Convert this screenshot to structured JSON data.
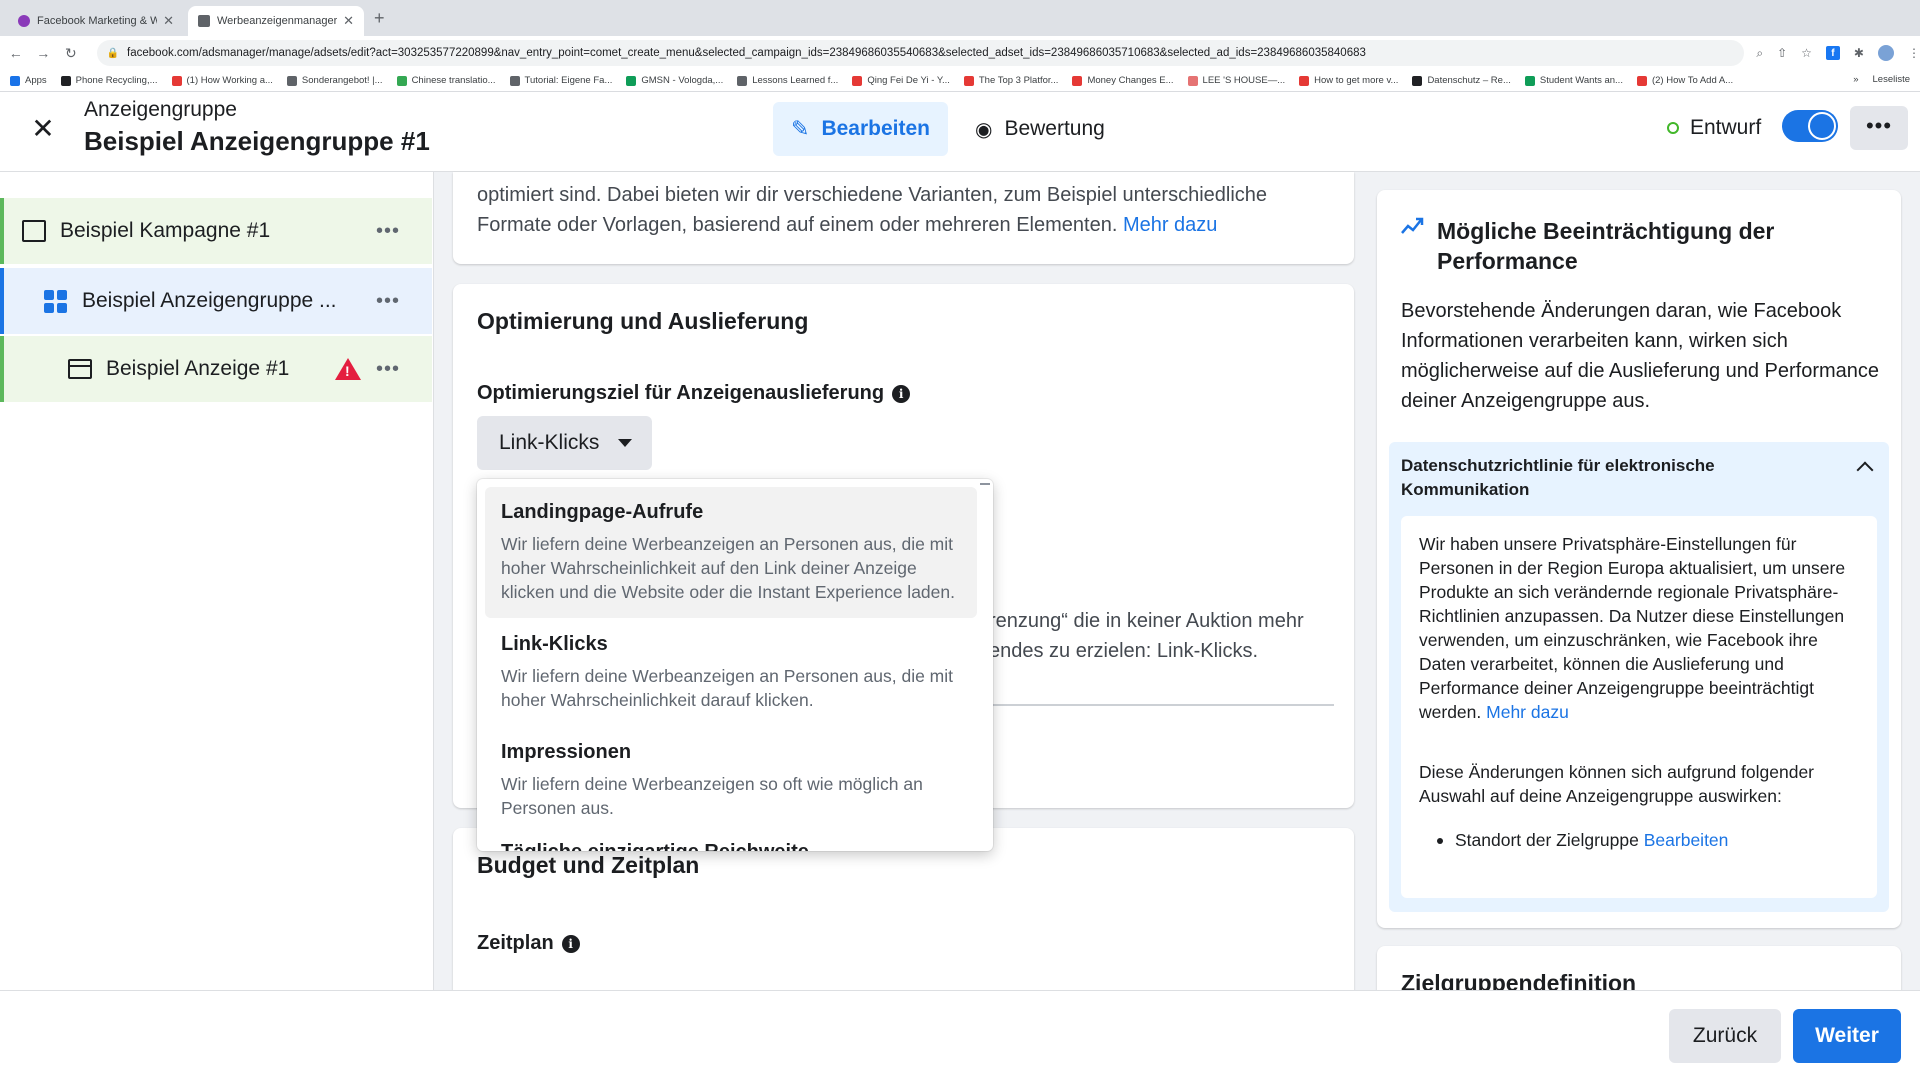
{
  "browser": {
    "tabs": [
      {
        "title": "Facebook Marketing & Werbe…",
        "favicon_color": "#8a3ab9"
      },
      {
        "title": "Werbeanzeigenmanager - We…",
        "favicon_color": "#5f6368"
      }
    ],
    "new_tab": "+",
    "url": "facebook.com/adsmanager/manage/adsets/edit?act=303253577220899&nav_entry_point=comet_create_menu&selected_campaign_ids=23849686035540683&selected_adset_ids=23849686035710683&selected_ad_ids=23849686035840683",
    "bookmarks": [
      {
        "label": "Apps",
        "color": "#1a73e8"
      },
      {
        "label": "Phone Recycling,...",
        "color": "#202124"
      },
      {
        "label": "(1) How Working a...",
        "color": "#e53935"
      },
      {
        "label": "Sonderangebot! |...",
        "color": "#5f6368"
      },
      {
        "label": "Chinese translatio...",
        "color": "#34a853"
      },
      {
        "label": "Tutorial: Eigene Fa...",
        "color": "#5f6368"
      },
      {
        "label": "GMSN - Vologda,...",
        "color": "#0f9d58"
      },
      {
        "label": "Lessons Learned f...",
        "color": "#5f6368"
      },
      {
        "label": "Qing Fei De Yi - Y...",
        "color": "#e53935"
      },
      {
        "label": "The Top 3 Platfor...",
        "color": "#e53935"
      },
      {
        "label": "Money Changes E...",
        "color": "#e53935"
      },
      {
        "label": "LEE 'S HOUSE—...",
        "color": "#e57373"
      },
      {
        "label": "How to get more v...",
        "color": "#e53935"
      },
      {
        "label": "Datenschutz – Re...",
        "color": "#202124"
      },
      {
        "label": "Student Wants an...",
        "color": "#0f9d58"
      },
      {
        "label": "(2) How To Add A...",
        "color": "#e53935"
      }
    ],
    "bookmarks_more": "»",
    "reading_list": "Leseliste"
  },
  "header": {
    "subtitle": "Anzeigengruppe",
    "title": "Beispiel Anzeigengruppe #1",
    "mode_edit": "Bearbeiten",
    "mode_review": "Bewertung",
    "status": "Entwurf",
    "more": "•••"
  },
  "sidebar": {
    "campaign": "Beispiel Kampagne #1",
    "adset": "Beispiel Anzeigengruppe ...",
    "ad": "Beispiel Anzeige #1",
    "dots": "•••"
  },
  "top_card": {
    "text": "optimiert sind. Dabei bieten wir dir verschiedene Varianten, zum Beispiel unterschiedliche Formate oder Vorlagen, basierend auf einem oder mehreren Elementen.",
    "link": "Mehr dazu"
  },
  "optimization": {
    "section_title": "Optimierung und Auslieferung",
    "goal_label": "Optimierungsziel für Anzeigenauslieferung",
    "selected": "Link-Klicks",
    "partial_text_1": "renzung“ die in keiner Auktion mehr",
    "partial_text_2": "endes zu erzielen: Link-Klicks."
  },
  "dropdown": {
    "options": [
      {
        "title": "Landingpage-Aufrufe",
        "desc": "Wir liefern deine Werbeanzeigen an Personen aus, die mit hoher Wahrscheinlichkeit auf den Link deiner Anzeige klicken und die Website oder die Instant Experience laden."
      },
      {
        "title": "Link-Klicks",
        "desc": "Wir liefern deine Werbeanzeigen an Personen aus, die mit hoher Wahrscheinlichkeit darauf klicken."
      },
      {
        "title": "Impressionen",
        "desc": "Wir liefern deine Werbeanzeigen so oft wie möglich an Personen aus."
      }
    ],
    "peek": "Tägliche einzigartige Reichweite"
  },
  "budget": {
    "section_title": "Budget und Zeitplan",
    "schedule_label": "Zeitplan"
  },
  "performance": {
    "title": "Mögliche Beeinträchtigung der Performance",
    "body": "Bevorstehende Änderungen daran, wie Facebook Informationen verarbeiten kann, wirken sich möglicherweise auf die Auslieferung und Performance deiner Anzeigengruppe aus.",
    "privacy_title": "Datenschutzrichtlinie für elektronische Kommunikation",
    "privacy_p1": "Wir haben unsere Privatsphäre-Einstellungen für Personen in der Region Europa aktualisiert, um unsere Produkte an sich verändernde regionale Privatsphäre-Richtlinien anzupassen. Da Nutzer diese Einstellungen verwenden, um einzuschränken, wie Facebook ihre Daten verarbeitet, können die Auslieferung und Performance deiner Anzeigengruppe beeinträchtigt werden.",
    "privacy_link": "Mehr dazu",
    "privacy_p2": "Diese Änderungen können sich aufgrund folgender Auswahl auf deine Anzeigengruppe auswirken:",
    "list_item": "Standort der Zielgruppe",
    "list_link": "Bearbeiten"
  },
  "target_card": {
    "title": "Zielgruppendefinition"
  },
  "footer": {
    "back": "Zurück",
    "next": "Weiter"
  },
  "colors": {
    "accent": "#1b74e4",
    "success": "#42b72a",
    "warning": "#e41e3f"
  }
}
